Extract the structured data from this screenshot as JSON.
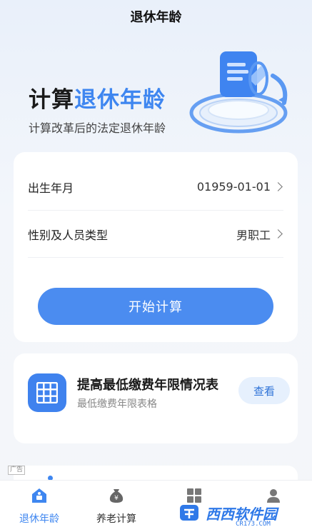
{
  "header": {
    "title": "退休年龄"
  },
  "hero": {
    "title_plain": "计算",
    "title_accent": "退休年龄",
    "subtitle": "计算改革后的法定退休年龄"
  },
  "form": {
    "birth_label": "出生年月",
    "birth_value": "01959-01-01",
    "type_label": "性别及人员类型",
    "type_value": "男职工",
    "submit_label": "开始计算"
  },
  "table_card": {
    "title": "提高最低缴费年限情况表",
    "subtitle": "最低缴费年限表格",
    "button": "查看"
  },
  "ad": {
    "tag": "广告"
  },
  "tabbar": {
    "items": [
      {
        "label": "退休年龄",
        "icon": "retire-icon",
        "active": true
      },
      {
        "label": "养老计算",
        "icon": "money-bag-icon",
        "active": false
      },
      {
        "label": "",
        "icon": "grid-icon",
        "active": false
      },
      {
        "label": "",
        "icon": "profile-icon",
        "active": false
      }
    ]
  },
  "watermark": {
    "text": "西西软件园",
    "sub": "CR173.COM"
  },
  "colors": {
    "accent": "#3e86f0",
    "button": "#4b8cf0",
    "view_button_bg": "#e6f0fd"
  }
}
